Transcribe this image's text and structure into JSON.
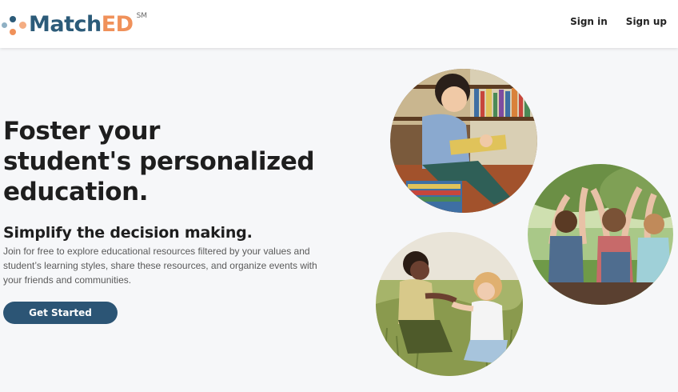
{
  "header": {
    "logo": {
      "match": "Match",
      "ed": "ED",
      "sm": "SM"
    },
    "nav": {
      "sign_in": "Sign in",
      "sign_up": "Sign up"
    }
  },
  "hero": {
    "title_lines": [
      "Foster your",
      "student's personalized",
      "education."
    ],
    "subtitle": "Simplify the decision making.",
    "description": "Join for free to explore educational resources filtered by your values and student’s learning styles, share these resources, and organize events with your friends and communities.",
    "cta": "Get Started"
  },
  "colors": {
    "brand_blue": "#2c5b79",
    "brand_orange": "#f0915a",
    "button": "#2c5575"
  }
}
